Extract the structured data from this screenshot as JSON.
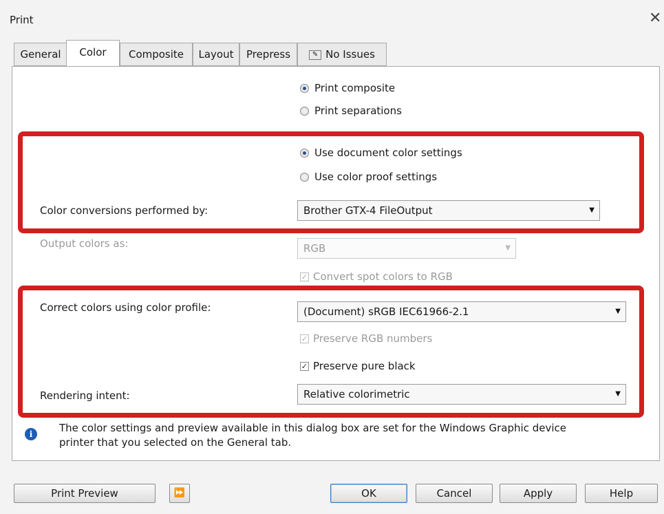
{
  "window": {
    "title": "Print",
    "close_glyph": "✕"
  },
  "tabs": [
    {
      "label": "General"
    },
    {
      "label": "Color"
    },
    {
      "label": "Composite"
    },
    {
      "label": "Layout"
    },
    {
      "label": "Prepress"
    },
    {
      "label": "No Issues",
      "icon": "issues-icon"
    }
  ],
  "active_tab": "Color",
  "print_mode": {
    "composite": {
      "label": "Print composite",
      "checked": true
    },
    "separations": {
      "label": "Print separations",
      "checked": false
    }
  },
  "color_source": {
    "document": {
      "label": "Use document color settings",
      "checked": true
    },
    "proof": {
      "label": "Use color proof settings",
      "checked": false
    }
  },
  "conversions": {
    "label": "Color conversions performed by:",
    "value": "Brother GTX-4 FileOutput"
  },
  "output": {
    "label": "Output colors as:",
    "value": "RGB",
    "disabled": true
  },
  "convert_spot": {
    "label": "Convert spot colors to RGB",
    "checked": true,
    "disabled": true
  },
  "correct": {
    "label": "Correct colors using color profile:",
    "value": "(Document) sRGB IEC61966-2.1"
  },
  "preserve_rgb": {
    "label": "Preserve RGB numbers",
    "checked": true,
    "disabled": true
  },
  "preserve_black": {
    "label": "Preserve pure black",
    "checked": true
  },
  "rendering": {
    "label": "Rendering intent:",
    "value": "Relative colorimetric"
  },
  "info": {
    "line1": "The color settings and preview available in this dialog box are set for the Windows Graphic device",
    "line2": "printer that you selected on the General tab."
  },
  "buttons": {
    "print_preview": "Print Preview",
    "expand_glyph": "⏩",
    "ok": "OK",
    "cancel": "Cancel",
    "apply": "Apply",
    "help": "Help"
  },
  "colors": {
    "highlight": "#d0201f",
    "info_icon": "#1b5fb5",
    "radio_dot": "#2a4f8a"
  }
}
